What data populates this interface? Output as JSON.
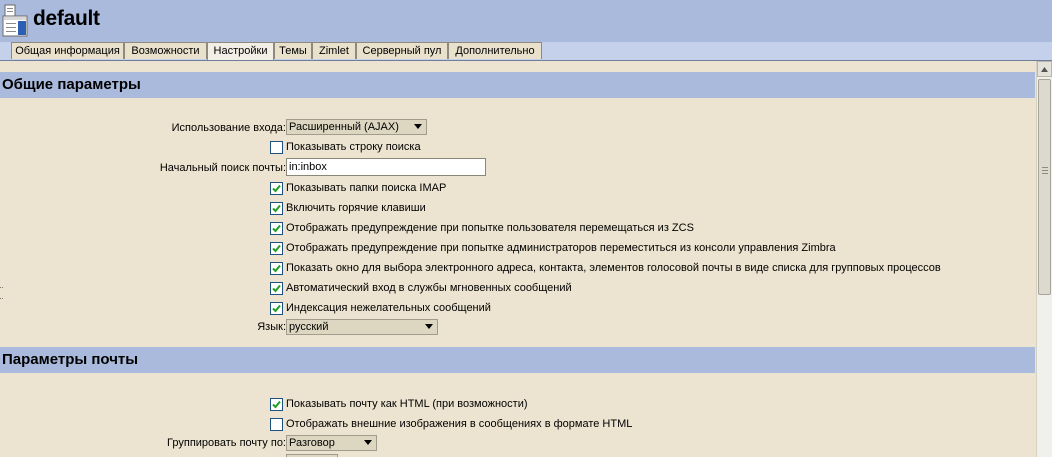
{
  "header": {
    "title": "default",
    "icon": "cos-document-icon"
  },
  "tabs": [
    {
      "label": "Общая информация",
      "active": false
    },
    {
      "label": "Возможности",
      "active": false
    },
    {
      "label": "Настройки",
      "active": true
    },
    {
      "label": "Темы",
      "active": false
    },
    {
      "label": "Zimlet",
      "active": false
    },
    {
      "label": "Серверный пул",
      "active": false
    },
    {
      "label": "Дополнительно",
      "active": false
    }
  ],
  "general": {
    "title": "Общие параметры",
    "login_usage_label": "Использование входа:",
    "login_usage_value": "Расширенный (AJAX)",
    "show_search_string": {
      "label": "Показывать строку поиска",
      "checked": false
    },
    "initial_search_label": "Начальный поиск почты:",
    "initial_search_value": "in:inbox",
    "show_imap_folders": {
      "label": "Показывать папки поиска IMAP",
      "checked": true
    },
    "enable_shortcuts": {
      "label": "Включить горячие клавиши",
      "checked": true
    },
    "warn_user_leave": {
      "label": "Отображать предупреждение при попытке пользователя перемещаться из ZCS",
      "checked": true
    },
    "warn_admin_leave": {
      "label": "Отображать предупреждение при попытке администраторов переместиться из консоли управления Zimbra",
      "checked": true
    },
    "show_address_picker": {
      "label": "Показать окно для выбора электронного адреса, контакта, элементов голосовой почты в виде списка для групповых процессов",
      "checked": true
    },
    "auto_im_login": {
      "label": "Автоматический вход в службы мгновенных сообщений",
      "checked": true
    },
    "index_junk": {
      "label": "Индексация нежелательных сообщений",
      "checked": true
    },
    "language_label": "Язык:",
    "language_value": "русский"
  },
  "mail": {
    "title": "Параметры почты",
    "show_html": {
      "label": "Показывать почту как HTML (при возможности)",
      "checked": true
    },
    "show_external_images": {
      "label": "Отображать внешние изображения в сообщениях в формате HTML",
      "checked": false
    },
    "group_by_label": "Группировать почту по:",
    "group_by_value": "Разговор"
  },
  "colors": {
    "header_blue": "#a9badc",
    "panel_beige": "#ece4d0",
    "check_green": "#21a121"
  }
}
